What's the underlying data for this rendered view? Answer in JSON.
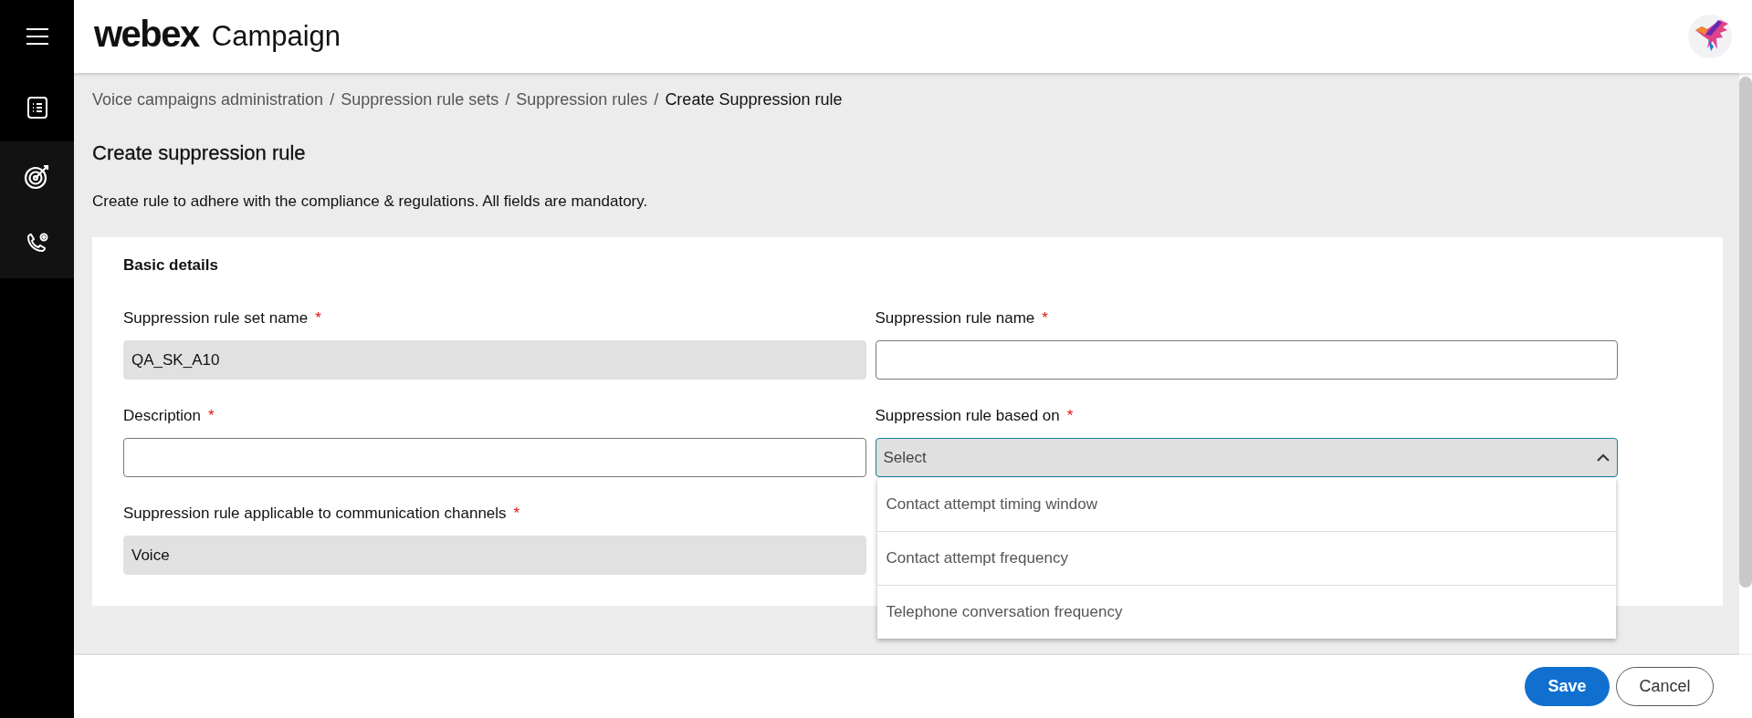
{
  "sidebar": {
    "items": [
      {
        "kind": "list",
        "selected": false
      },
      {
        "kind": "target",
        "selected": true
      },
      {
        "kind": "phone",
        "selected": true
      }
    ]
  },
  "header": {
    "logo": "webex",
    "product": "Campaign"
  },
  "breadcrumbs": [
    {
      "label": "Voice campaigns administration",
      "current": false
    },
    {
      "label": "Suppression rule sets",
      "current": false
    },
    {
      "label": "Suppression rules",
      "current": false
    },
    {
      "label": "Create Suppression rule",
      "current": true
    }
  ],
  "breadcrumb_separator": "/",
  "page_title": "Create suppression rule",
  "intro": "Create rule to adhere with the compliance & regulations. All fields are mandatory.",
  "form": {
    "section_title": "Basic details",
    "fields": [
      {
        "kind": "text",
        "label": "Suppression rule set name",
        "required_mark": "*",
        "value": "QA_SK_A10",
        "disabled": true
      },
      {
        "kind": "text",
        "label": "Suppression rule name",
        "required_mark": "*",
        "disabled": false
      },
      {
        "kind": "text",
        "label": "Description",
        "required_mark": "*",
        "disabled": false
      },
      {
        "kind": "select",
        "label": "Suppression rule based on",
        "required_mark": "*",
        "placeholder": "Select",
        "expanded": true,
        "options": [
          "Contact attempt timing window",
          "Contact attempt frequency",
          "Telephone conversation frequency"
        ]
      },
      {
        "kind": "text",
        "label": "Suppression rule applicable to communication channels",
        "required_mark": "*",
        "value": "Voice",
        "disabled": true
      }
    ]
  },
  "footer": {
    "buttons": [
      {
        "label": "Save",
        "kind": "primary"
      },
      {
        "label": "Cancel",
        "kind": "secondary"
      }
    ]
  }
}
